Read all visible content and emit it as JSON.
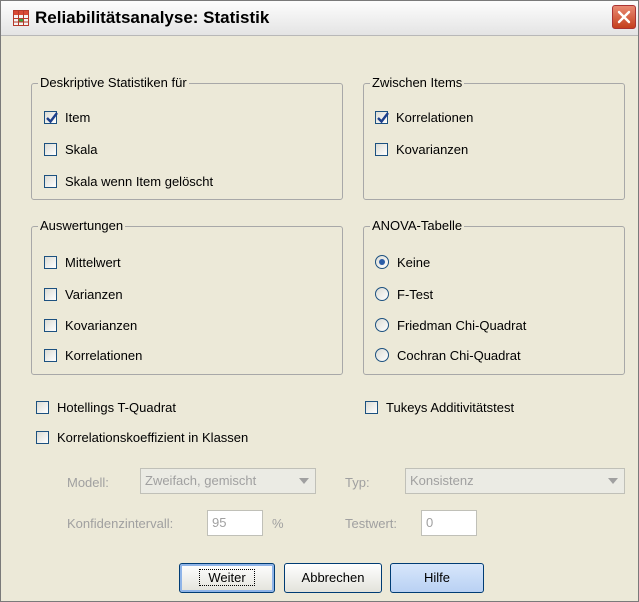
{
  "window": {
    "title": "Reliabilitätsanalyse: Statistik"
  },
  "descriptive": {
    "legend": "Deskriptive Statistiken für",
    "items": [
      {
        "label": "Item",
        "checked": true
      },
      {
        "label": "Skala",
        "checked": false
      },
      {
        "label": "Skala wenn Item gelöscht",
        "checked": false
      }
    ]
  },
  "between_items": {
    "legend": "Zwischen Items",
    "items": [
      {
        "label": "Korrelationen",
        "checked": true
      },
      {
        "label": "Kovarianzen",
        "checked": false
      }
    ]
  },
  "summaries": {
    "legend": "Auswertungen",
    "items": [
      {
        "label": "Mittelwert",
        "checked": false
      },
      {
        "label": "Varianzen",
        "checked": false
      },
      {
        "label": "Kovarianzen",
        "checked": false
      },
      {
        "label": "Korrelationen",
        "checked": false
      }
    ]
  },
  "anova": {
    "legend": "ANOVA-Tabelle",
    "options": [
      {
        "label": "Keine",
        "selected": true
      },
      {
        "label": "F-Test",
        "selected": false
      },
      {
        "label": "Friedman Chi-Quadrat",
        "selected": false
      },
      {
        "label": "Cochran Chi-Quadrat",
        "selected": false
      }
    ]
  },
  "extra": {
    "hotelling": "Hotellings T-Quadrat",
    "tukey": "Tukeys Additivitätstest",
    "icc": "Korrelationskoeffizient in Klassen"
  },
  "icc_settings": {
    "model_label": "Modell:",
    "model_value": "Zweifach, gemischt",
    "type_label": "Typ:",
    "type_value": "Konsistenz",
    "ci_label": "Konfidenzintervall:",
    "ci_value": "95",
    "ci_unit": "%",
    "test_label": "Testwert:",
    "test_value": "0"
  },
  "buttons": {
    "continue": "Weiter",
    "cancel": "Abbrechen",
    "help": "Hilfe"
  }
}
